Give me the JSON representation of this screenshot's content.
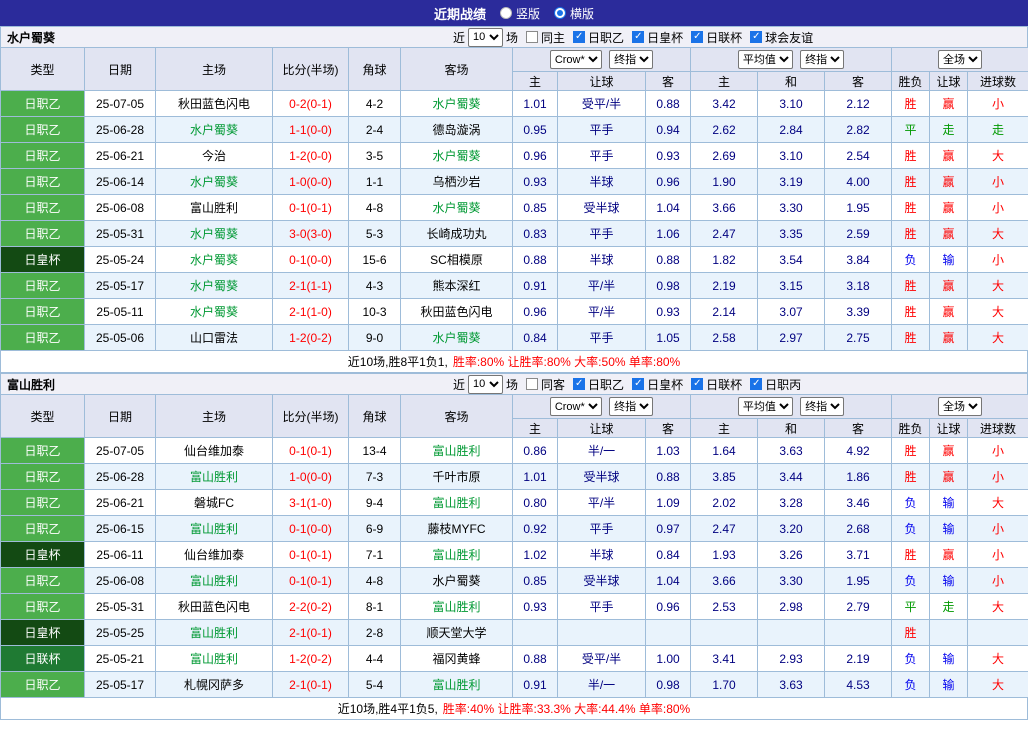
{
  "topbar": {
    "title": "近期战绩",
    "vertical_label": "竖版",
    "horizontal_label": "横版"
  },
  "colors": {
    "topbar_bg": "#2b2b9b",
    "league_badge_green": "#4cae4c",
    "emperor_cup_dark_green": "#134a13",
    "league_cup_green": "#1f7a33",
    "win_red": "#ff0000",
    "lose_blue": "#0000ee",
    "draw_green": "#009900",
    "odds_navy": "#000080",
    "team_highlight_green": "#009933",
    "row_alt_blue": "#e9f3fc",
    "grid_border": "#9ebcd9",
    "checkbox_blue": "#1a73e8"
  },
  "sections": [
    {
      "team": "水户蜀葵",
      "filter": {
        "recent_label": "近",
        "count": "10",
        "games_label": "场",
        "same_label": "同主",
        "leagues": [
          "日职乙",
          "日皇杯",
          "日联杯",
          "球会友谊"
        ]
      },
      "header": {
        "cols": [
          "类型",
          "日期",
          "主场",
          "比分(半场)",
          "角球",
          "客场"
        ],
        "odds_company": "Crow*",
        "odds_final": "终指",
        "avg_label": "平均值",
        "avg_final": "终指",
        "full_label": "全场",
        "sub": [
          "主",
          "让球",
          "客",
          "主",
          "和",
          "客",
          "胜负",
          "让球",
          "进球数"
        ]
      },
      "rows": [
        {
          "type": "日职乙",
          "tclass": "j2",
          "date": "25-07-05",
          "home": "秋田蓝色闪电",
          "home_hl": false,
          "score": "0-2(0-1)",
          "corner": "4-2",
          "away": "水户蜀葵",
          "away_hl": true,
          "odds_home": "1.01",
          "line": "受平/半",
          "odds_away": "0.88",
          "avg_home": "3.42",
          "avg_draw": "3.10",
          "avg_away": "2.12",
          "res_wl": "胜",
          "res_wl_c": "red",
          "res_h": "赢",
          "res_h_c": "red",
          "res_g": "小",
          "res_g_c": "red"
        },
        {
          "type": "日职乙",
          "tclass": "j2",
          "date": "25-06-28",
          "home": "水户蜀葵",
          "home_hl": true,
          "score": "1-1(0-0)",
          "corner": "2-4",
          "away": "德岛漩涡",
          "away_hl": false,
          "odds_home": "0.95",
          "line": "平手",
          "odds_away": "0.94",
          "avg_home": "2.62",
          "avg_draw": "2.84",
          "avg_away": "2.82",
          "res_wl": "平",
          "res_wl_c": "green",
          "res_h": "走",
          "res_h_c": "green",
          "res_g": "走",
          "res_g_c": "green"
        },
        {
          "type": "日职乙",
          "tclass": "j2",
          "date": "25-06-21",
          "home": "今治",
          "home_hl": false,
          "score": "1-2(0-0)",
          "corner": "3-5",
          "away": "水户蜀葵",
          "away_hl": true,
          "odds_home": "0.96",
          "line": "平手",
          "odds_away": "0.93",
          "avg_home": "2.69",
          "avg_draw": "3.10",
          "avg_away": "2.54",
          "res_wl": "胜",
          "res_wl_c": "red",
          "res_h": "赢",
          "res_h_c": "red",
          "res_g": "大",
          "res_g_c": "red"
        },
        {
          "type": "日职乙",
          "tclass": "j2",
          "date": "25-06-14",
          "home": "水户蜀葵",
          "home_hl": true,
          "score": "1-0(0-0)",
          "corner": "1-1",
          "away": "乌栖沙岩",
          "away_hl": false,
          "odds_home": "0.93",
          "line": "半球",
          "odds_away": "0.96",
          "avg_home": "1.90",
          "avg_draw": "3.19",
          "avg_away": "4.00",
          "res_wl": "胜",
          "res_wl_c": "red",
          "res_h": "赢",
          "res_h_c": "red",
          "res_g": "小",
          "res_g_c": "red"
        },
        {
          "type": "日职乙",
          "tclass": "j2",
          "date": "25-06-08",
          "home": "富山胜利",
          "home_hl": false,
          "score": "0-1(0-1)",
          "corner": "4-8",
          "away": "水户蜀葵",
          "away_hl": true,
          "odds_home": "0.85",
          "line": "受半球",
          "odds_away": "1.04",
          "avg_home": "3.66",
          "avg_draw": "3.30",
          "avg_away": "1.95",
          "res_wl": "胜",
          "res_wl_c": "red",
          "res_h": "赢",
          "res_h_c": "red",
          "res_g": "小",
          "res_g_c": "red"
        },
        {
          "type": "日职乙",
          "tclass": "j2",
          "date": "25-05-31",
          "home": "水户蜀葵",
          "home_hl": true,
          "score": "3-0(3-0)",
          "corner": "5-3",
          "away": "长崎成功丸",
          "away_hl": false,
          "odds_home": "0.83",
          "line": "平手",
          "odds_away": "1.06",
          "avg_home": "2.47",
          "avg_draw": "3.35",
          "avg_away": "2.59",
          "res_wl": "胜",
          "res_wl_c": "red",
          "res_h": "赢",
          "res_h_c": "red",
          "res_g": "大",
          "res_g_c": "red"
        },
        {
          "type": "日皇杯",
          "tclass": "cup",
          "date": "25-05-24",
          "home": "水户蜀葵",
          "home_hl": true,
          "score": "0-1(0-0)",
          "corner": "15-6",
          "away": "SC相模原",
          "away_hl": false,
          "odds_home": "0.88",
          "line": "半球",
          "odds_away": "0.88",
          "avg_home": "1.82",
          "avg_draw": "3.54",
          "avg_away": "3.84",
          "res_wl": "负",
          "res_wl_c": "blue",
          "res_h": "输",
          "res_h_c": "blue",
          "res_g": "小",
          "res_g_c": "red"
        },
        {
          "type": "日职乙",
          "tclass": "j2",
          "date": "25-05-17",
          "home": "水户蜀葵",
          "home_hl": true,
          "score": "2-1(1-1)",
          "corner": "4-3",
          "away": "熊本深红",
          "away_hl": false,
          "odds_home": "0.91",
          "line": "平/半",
          "odds_away": "0.98",
          "avg_home": "2.19",
          "avg_draw": "3.15",
          "avg_away": "3.18",
          "res_wl": "胜",
          "res_wl_c": "red",
          "res_h": "赢",
          "res_h_c": "red",
          "res_g": "大",
          "res_g_c": "red"
        },
        {
          "type": "日职乙",
          "tclass": "j2",
          "date": "25-05-11",
          "home": "水户蜀葵",
          "home_hl": true,
          "score": "2-1(1-0)",
          "corner": "10-3",
          "away": "秋田蓝色闪电",
          "away_hl": false,
          "odds_home": "0.96",
          "line": "平/半",
          "odds_away": "0.93",
          "avg_home": "2.14",
          "avg_draw": "3.07",
          "avg_away": "3.39",
          "res_wl": "胜",
          "res_wl_c": "red",
          "res_h": "赢",
          "res_h_c": "red",
          "res_g": "大",
          "res_g_c": "red"
        },
        {
          "type": "日职乙",
          "tclass": "j2",
          "date": "25-05-06",
          "home": "山口雷法",
          "home_hl": false,
          "score": "1-2(0-2)",
          "corner": "9-0",
          "away": "水户蜀葵",
          "away_hl": true,
          "odds_home": "0.84",
          "line": "平手",
          "odds_away": "1.05",
          "avg_home": "2.58",
          "avg_draw": "2.97",
          "avg_away": "2.75",
          "res_wl": "胜",
          "res_wl_c": "red",
          "res_h": "赢",
          "res_h_c": "red",
          "res_g": "大",
          "res_g_c": "red"
        }
      ],
      "summary": {
        "plain": "近10场,胜8平1负1,",
        "red": "胜率:80% 让胜率:80% 大率:50% 单率:80%"
      }
    },
    {
      "team": "富山胜利",
      "filter": {
        "recent_label": "近",
        "count": "10",
        "games_label": "场",
        "same_label": "同客",
        "leagues": [
          "日职乙",
          "日皇杯",
          "日联杯",
          "日职丙"
        ]
      },
      "header": {
        "cols": [
          "类型",
          "日期",
          "主场",
          "比分(半场)",
          "角球",
          "客场"
        ],
        "odds_company": "Crow*",
        "odds_final": "终指",
        "avg_label": "平均值",
        "avg_final": "终指",
        "full_label": "全场",
        "sub": [
          "主",
          "让球",
          "客",
          "主",
          "和",
          "客",
          "胜负",
          "让球",
          "进球数"
        ]
      },
      "rows": [
        {
          "type": "日职乙",
          "tclass": "j2",
          "date": "25-07-05",
          "home": "仙台维加泰",
          "home_hl": false,
          "score": "0-1(0-1)",
          "corner": "13-4",
          "away": "富山胜利",
          "away_hl": true,
          "odds_home": "0.86",
          "line": "半/一",
          "odds_away": "1.03",
          "avg_home": "1.64",
          "avg_draw": "3.63",
          "avg_away": "4.92",
          "res_wl": "胜",
          "res_wl_c": "red",
          "res_h": "赢",
          "res_h_c": "red",
          "res_g": "小",
          "res_g_c": "red"
        },
        {
          "type": "日职乙",
          "tclass": "j2",
          "date": "25-06-28",
          "home": "富山胜利",
          "home_hl": true,
          "score": "1-0(0-0)",
          "corner": "7-3",
          "away": "千叶市原",
          "away_hl": false,
          "odds_home": "1.01",
          "line": "受半球",
          "odds_away": "0.88",
          "avg_home": "3.85",
          "avg_draw": "3.44",
          "avg_away": "1.86",
          "res_wl": "胜",
          "res_wl_c": "red",
          "res_h": "赢",
          "res_h_c": "red",
          "res_g": "小",
          "res_g_c": "red"
        },
        {
          "type": "日职乙",
          "tclass": "j2",
          "date": "25-06-21",
          "home": "磐城FC",
          "home_hl": false,
          "score": "3-1(1-0)",
          "corner": "9-4",
          "away": "富山胜利",
          "away_hl": true,
          "odds_home": "0.80",
          "line": "平/半",
          "odds_away": "1.09",
          "avg_home": "2.02",
          "avg_draw": "3.28",
          "avg_away": "3.46",
          "res_wl": "负",
          "res_wl_c": "blue",
          "res_h": "输",
          "res_h_c": "blue",
          "res_g": "大",
          "res_g_c": "red"
        },
        {
          "type": "日职乙",
          "tclass": "j2",
          "date": "25-06-15",
          "home": "富山胜利",
          "home_hl": true,
          "score": "0-1(0-0)",
          "corner": "6-9",
          "away": "藤枝MYFC",
          "away_hl": false,
          "odds_home": "0.92",
          "line": "平手",
          "odds_away": "0.97",
          "avg_home": "2.47",
          "avg_draw": "3.20",
          "avg_away": "2.68",
          "res_wl": "负",
          "res_wl_c": "blue",
          "res_h": "输",
          "res_h_c": "blue",
          "res_g": "小",
          "res_g_c": "red"
        },
        {
          "type": "日皇杯",
          "tclass": "cup",
          "date": "25-06-11",
          "home": "仙台维加泰",
          "home_hl": false,
          "score": "0-1(0-1)",
          "corner": "7-1",
          "away": "富山胜利",
          "away_hl": true,
          "odds_home": "1.02",
          "line": "半球",
          "odds_away": "0.84",
          "avg_home": "1.93",
          "avg_draw": "3.26",
          "avg_away": "3.71",
          "res_wl": "胜",
          "res_wl_c": "red",
          "res_h": "赢",
          "res_h_c": "red",
          "res_g": "小",
          "res_g_c": "red"
        },
        {
          "type": "日职乙",
          "tclass": "j2",
          "date": "25-06-08",
          "home": "富山胜利",
          "home_hl": true,
          "score": "0-1(0-1)",
          "corner": "4-8",
          "away": "水户蜀葵",
          "away_hl": false,
          "odds_home": "0.85",
          "line": "受半球",
          "odds_away": "1.04",
          "avg_home": "3.66",
          "avg_draw": "3.30",
          "avg_away": "1.95",
          "res_wl": "负",
          "res_wl_c": "blue",
          "res_h": "输",
          "res_h_c": "blue",
          "res_g": "小",
          "res_g_c": "red"
        },
        {
          "type": "日职乙",
          "tclass": "j2",
          "date": "25-05-31",
          "home": "秋田蓝色闪电",
          "home_hl": false,
          "score": "2-2(0-2)",
          "corner": "8-1",
          "away": "富山胜利",
          "away_hl": true,
          "odds_home": "0.93",
          "line": "平手",
          "odds_away": "0.96",
          "avg_home": "2.53",
          "avg_draw": "2.98",
          "avg_away": "2.79",
          "res_wl": "平",
          "res_wl_c": "green",
          "res_h": "走",
          "res_h_c": "green",
          "res_g": "大",
          "res_g_c": "red"
        },
        {
          "type": "日皇杯",
          "tclass": "cup",
          "date": "25-05-25",
          "home": "富山胜利",
          "home_hl": true,
          "score": "2-1(0-1)",
          "corner": "2-8",
          "away": "顺天堂大学",
          "away_hl": false,
          "odds_home": "",
          "line": "",
          "odds_away": "",
          "avg_home": "",
          "avg_draw": "",
          "avg_away": "",
          "res_wl": "胜",
          "res_wl_c": "red",
          "res_h": "",
          "res_h_c": "",
          "res_g": "",
          "res_g_c": ""
        },
        {
          "type": "日联杯",
          "tclass": "lc",
          "date": "25-05-21",
          "home": "富山胜利",
          "home_hl": true,
          "score": "1-2(0-2)",
          "corner": "4-4",
          "away": "福冈黄蜂",
          "away_hl": false,
          "odds_home": "0.88",
          "line": "受平/半",
          "odds_away": "1.00",
          "avg_home": "3.41",
          "avg_draw": "2.93",
          "avg_away": "2.19",
          "res_wl": "负",
          "res_wl_c": "blue",
          "res_h": "输",
          "res_h_c": "blue",
          "res_g": "大",
          "res_g_c": "red"
        },
        {
          "type": "日职乙",
          "tclass": "j2",
          "date": "25-05-17",
          "home": "札幌冈萨多",
          "home_hl": false,
          "score": "2-1(0-1)",
          "corner": "5-4",
          "away": "富山胜利",
          "away_hl": true,
          "odds_home": "0.91",
          "line": "半/一",
          "odds_away": "0.98",
          "avg_home": "1.70",
          "avg_draw": "3.63",
          "avg_away": "4.53",
          "res_wl": "负",
          "res_wl_c": "blue",
          "res_h": "输",
          "res_h_c": "blue",
          "res_g": "大",
          "res_g_c": "red"
        }
      ],
      "summary": {
        "plain": "近10场,胜4平1负5,",
        "red": "胜率:40% 让胜率:33.3% 大率:44.4% 单率:80%"
      }
    }
  ]
}
